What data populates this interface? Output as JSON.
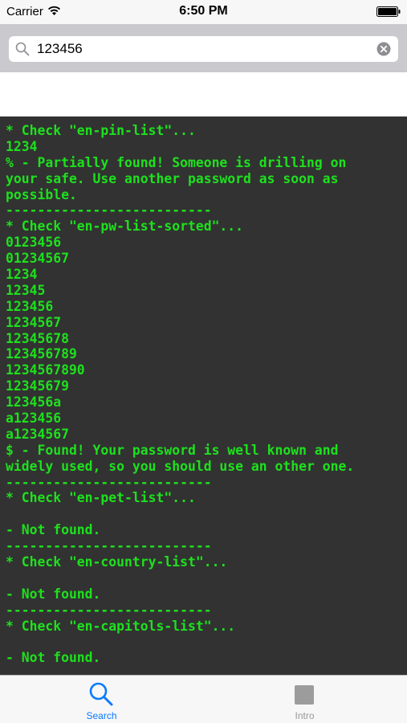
{
  "status_bar": {
    "carrier": "Carrier",
    "time": "6:50 PM",
    "wifi_icon": "wifi-icon",
    "battery_icon": "battery-icon"
  },
  "search": {
    "value": "123456",
    "search_icon": "search-icon",
    "clear_icon": "clear-circle-icon"
  },
  "console": {
    "text_color": "#1ee01e",
    "background": "#323232",
    "lines": [
      "* Check \"en-pin-list\"...",
      "1234",
      "% - Partially found! Someone is drilling on",
      "your safe. Use another password as soon as",
      "possible.",
      "--------------------------",
      "* Check \"en-pw-list-sorted\"...",
      "0123456",
      "01234567",
      "1234",
      "12345",
      "123456",
      "1234567",
      "12345678",
      "123456789",
      "1234567890",
      "12345679",
      "123456a",
      "a123456",
      "a1234567",
      "$ - Found! Your password is well known and",
      "widely used, so you should use an other one.",
      "--------------------------",
      "* Check \"en-pet-list\"...",
      "",
      "- Not found.",
      "--------------------------",
      "* Check \"en-country-list\"...",
      "",
      "- Not found.",
      "--------------------------",
      "* Check \"en-capitols-list\"...",
      "",
      "- Not found."
    ]
  },
  "tab_bar": {
    "active_color": "#0a7aff",
    "inactive_color": "#999999",
    "tabs": [
      {
        "label": "Search",
        "icon": "magnifier-icon",
        "active": true
      },
      {
        "label": "Intro",
        "icon": "square-icon",
        "active": false
      }
    ]
  }
}
